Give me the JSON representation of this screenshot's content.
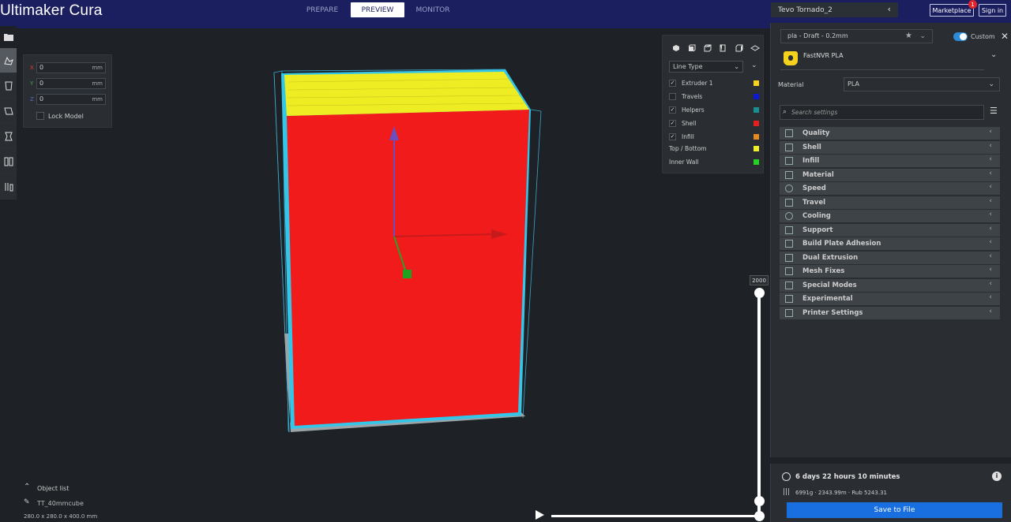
{
  "app": {
    "title": "Ultimaker Cura"
  },
  "stages": [
    {
      "label": "PREPARE",
      "active": false
    },
    {
      "label": "PREVIEW",
      "active": true
    },
    {
      "label": "MONITOR",
      "active": false
    }
  ],
  "printer": {
    "name": "Tevo Tornado_2"
  },
  "header_buttons": {
    "marketplace": "Marketplace",
    "marketplace_badge": "1",
    "signin": "Sign in"
  },
  "move_panel": {
    "x": {
      "letter": "X",
      "value": "0",
      "unit": "mm",
      "color": "#e53935"
    },
    "y": {
      "letter": "Y",
      "value": "0",
      "unit": "mm",
      "color": "#43a047"
    },
    "z": {
      "letter": "Z",
      "value": "0",
      "unit": "mm",
      "color": "#3f51b5"
    },
    "lock_label": "Lock Model"
  },
  "view_panel": {
    "line_type": "Line Type",
    "legend": [
      {
        "label": "Extruder 1",
        "checked": true,
        "checkbox": true,
        "color": "#f4d21d"
      },
      {
        "label": "Travels",
        "checked": false,
        "checkbox": true,
        "color": "#0b18d6"
      },
      {
        "label": "Helpers",
        "checked": true,
        "checkbox": true,
        "color": "#1a8f8f"
      },
      {
        "label": "Shell",
        "checked": true,
        "checkbox": true,
        "color": "#e51f1f"
      },
      {
        "label": "Infill",
        "checked": true,
        "checkbox": true,
        "color": "#e58a1f"
      },
      {
        "label": "Top / Bottom",
        "checked": false,
        "checkbox": false,
        "color": "#f0ee28"
      },
      {
        "label": "Inner Wall",
        "checked": false,
        "checkbox": false,
        "color": "#22d322"
      }
    ]
  },
  "layer_slider": {
    "max_label": "2000"
  },
  "object_list": {
    "title": "Object list",
    "object_name": "TT_40mmcube",
    "dimensions": "280.0 x 280.0 x 400.0 mm"
  },
  "settings": {
    "profile": "pla - Draft - 0.2mm",
    "custom_label": "Custom",
    "extruder_material_name": "FastNVR PLA",
    "material_label": "Material",
    "material_value": "PLA",
    "search_placeholder": "Search settings",
    "categories": [
      {
        "label": "Quality"
      },
      {
        "label": "Shell"
      },
      {
        "label": "Infill"
      },
      {
        "label": "Material"
      },
      {
        "label": "Speed"
      },
      {
        "label": "Travel"
      },
      {
        "label": "Cooling"
      },
      {
        "label": "Support"
      },
      {
        "label": "Build Plate Adhesion"
      },
      {
        "label": "Dual Extrusion"
      },
      {
        "label": "Mesh Fixes"
      },
      {
        "label": "Special Modes"
      },
      {
        "label": "Experimental"
      },
      {
        "label": "Printer Settings"
      }
    ]
  },
  "action_panel": {
    "print_time": "6 days 22 hours 10 minutes",
    "material_summary": "6991g · 2343.99m · Rub 5243.31",
    "save_label": "Save to File"
  },
  "colors": {
    "header_bg": "#1c1f5f",
    "accent_blue": "#196ee0",
    "shell_red": "#e51f1f",
    "top_yellow": "#f0ee28"
  }
}
